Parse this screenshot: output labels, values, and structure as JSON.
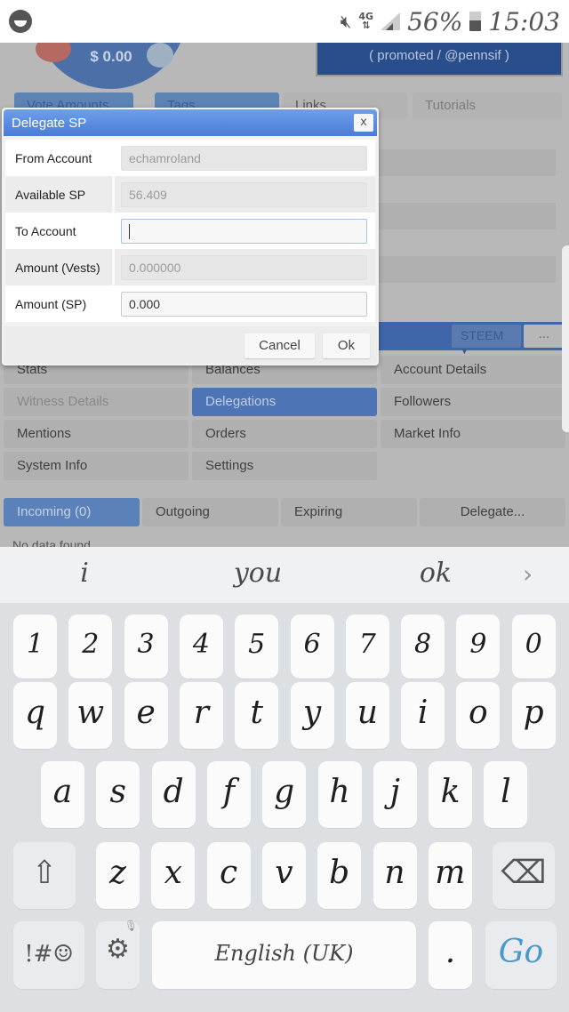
{
  "status_bar": {
    "app_icon": "messenger-face-icon",
    "icons": [
      "mute-icon",
      "4g-data-icon",
      "signal-icon",
      "battery-icon"
    ],
    "network": "4G",
    "battery": "56%",
    "time": "15:03"
  },
  "page": {
    "vote_value": "$ 0.00",
    "promoted": "( promoted / @pennsif )",
    "top_tabs": [
      "Vote Amounts",
      "Tags",
      "Links",
      "Tutorials"
    ],
    "currency_select": "STEEM",
    "more_button": "...",
    "menu": [
      {
        "label": "Stats",
        "state": "normal"
      },
      {
        "label": "Balances",
        "state": "normal"
      },
      {
        "label": "Account Details",
        "state": "normal"
      },
      {
        "label": "Witness Details",
        "state": "disabled"
      },
      {
        "label": "Delegations",
        "state": "active"
      },
      {
        "label": "Followers",
        "state": "normal"
      },
      {
        "label": "Mentions",
        "state": "normal"
      },
      {
        "label": "Orders",
        "state": "normal"
      },
      {
        "label": "Market Info",
        "state": "normal"
      },
      {
        "label": "System Info",
        "state": "normal"
      },
      {
        "label": "Settings",
        "state": "normal"
      }
    ],
    "delegation_tabs": [
      "Incoming (0)",
      "Outgoing",
      "Expiring",
      "Delegate..."
    ],
    "no_data": "No data found"
  },
  "modal": {
    "title": "Delegate SP",
    "close_label": "x",
    "fields": [
      {
        "label": "From Account",
        "value": "echamroland",
        "readonly": true
      },
      {
        "label": "Available SP",
        "value": "56.409",
        "readonly": true
      },
      {
        "label": "To Account",
        "value": "",
        "readonly": false,
        "focused": true
      },
      {
        "label": "Amount (Vests)",
        "value": "0.000000",
        "readonly": true
      },
      {
        "label": "Amount (SP)",
        "value": "0.000",
        "readonly": false
      }
    ],
    "cancel_label": "Cancel",
    "ok_label": "Ok"
  },
  "keyboard": {
    "suggestions": [
      "i",
      "you",
      "ok"
    ],
    "suggest_more": "›",
    "row_numbers": [
      "1",
      "2",
      "3",
      "4",
      "5",
      "6",
      "7",
      "8",
      "9",
      "0"
    ],
    "row_top": [
      "q",
      "w",
      "e",
      "r",
      "t",
      "y",
      "u",
      "i",
      "o",
      "p"
    ],
    "row_mid": [
      "a",
      "s",
      "d",
      "f",
      "g",
      "h",
      "j",
      "k",
      "l"
    ],
    "row_bottom": [
      "z",
      "x",
      "c",
      "v",
      "b",
      "n",
      "m"
    ],
    "shift_icon": "⇧",
    "backspace_icon": "⌫",
    "symbols_label": "!#☺",
    "settings_icon": "⚙",
    "space_label": "English (UK)",
    "period_label": ".",
    "go_label": "Go",
    "go_color": "#4a98c9"
  }
}
